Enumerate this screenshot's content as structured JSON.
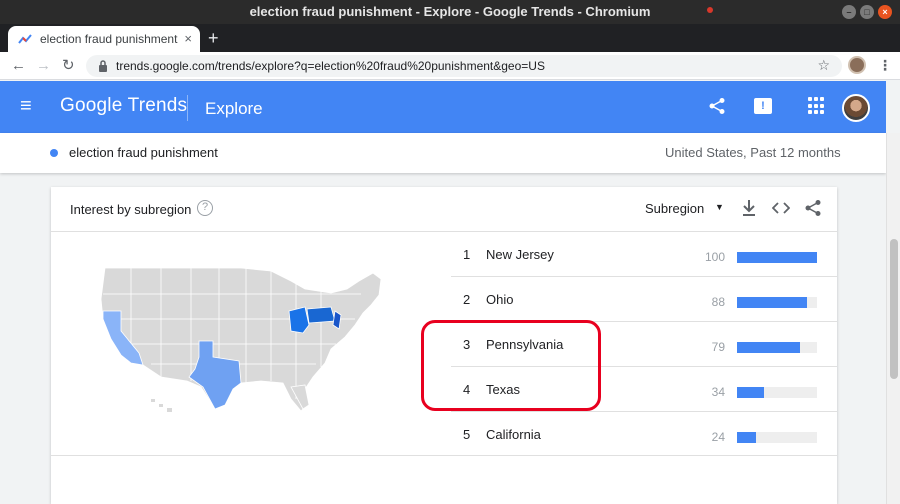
{
  "window": {
    "title": "election fraud punishment - Explore - Google Trends - Chromium",
    "min": "–",
    "max": "□",
    "close": "×"
  },
  "tab": {
    "title": "election fraud punishment",
    "close": "×",
    "new_tab": "+"
  },
  "toolbar": {
    "back": "←",
    "forward": "→",
    "reload": "↻",
    "url": "trends.google.com/trends/explore?q=election%20fraud%20punishment&geo=US",
    "star": "☆",
    "menu": "⋮"
  },
  "header": {
    "menu": "≡",
    "logo": "Google Trends",
    "section": "Explore",
    "share": "⋖",
    "feedback": "!"
  },
  "term": {
    "text": "election fraud punishment",
    "scope": "United States, Past 12 months",
    "color": "#4285f4"
  },
  "card": {
    "title": "Interest by subregion",
    "help": "?",
    "selector": "Subregion",
    "arrow": "▼",
    "download": "⭳",
    "embed": "<>",
    "share": "⋖"
  },
  "rankings": [
    {
      "rank": "1",
      "name": "New Jersey",
      "value": "100",
      "fill": 100
    },
    {
      "rank": "2",
      "name": "Ohio",
      "value": "88",
      "fill": 88
    },
    {
      "rank": "3",
      "name": "Pennsylvania",
      "value": "79",
      "fill": 79
    },
    {
      "rank": "4",
      "name": "Texas",
      "value": "34",
      "fill": 34
    },
    {
      "rank": "5",
      "name": "California",
      "value": "24",
      "fill": 24
    }
  ],
  "colors": {
    "brand": "#4285f4",
    "highlight": "#e8001f"
  }
}
